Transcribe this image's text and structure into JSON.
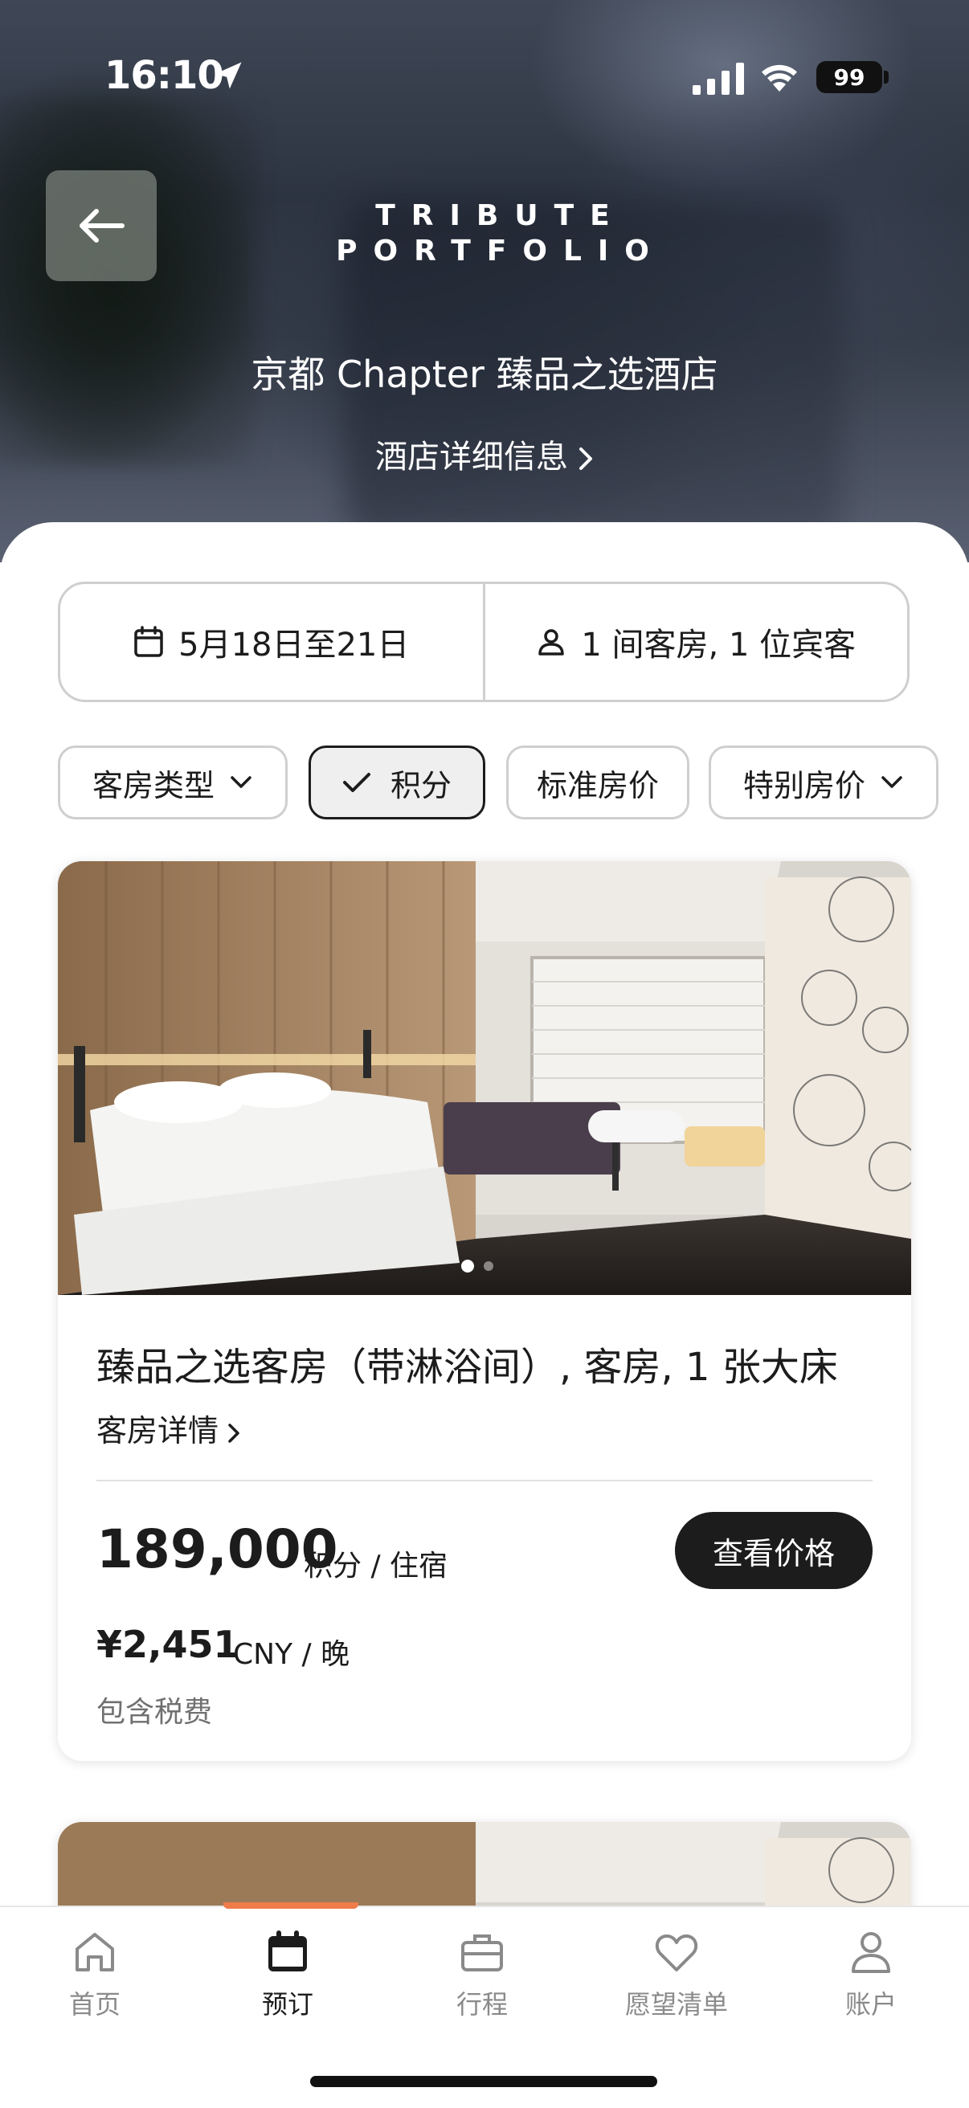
{
  "status_bar": {
    "time": "16:10",
    "battery": "99"
  },
  "hero": {
    "brand_line1": "TRIBUTE",
    "brand_line2": "PORTFOLIO",
    "hotel_name": "京都 Chapter 臻品之选酒店",
    "details_link": "酒店详细信息"
  },
  "search": {
    "dates": "5月18日至21日",
    "guests": "1 间客房, 1 位宾客"
  },
  "filters": [
    {
      "label": "客房类型",
      "has_dropdown": true,
      "selected": false
    },
    {
      "label": "积分",
      "has_check": true,
      "selected": true
    },
    {
      "label": "标准房价",
      "selected": false
    },
    {
      "label": "特别房价",
      "has_dropdown": true,
      "selected": false
    }
  ],
  "room_card": {
    "title": "臻品之选客房（带淋浴间）, 客房, 1 张大床",
    "details_link": "客房详情",
    "points": "189,000",
    "points_unit": "积分 / 住宿",
    "cash": "¥2,451",
    "cash_unit": "CNY / 晚",
    "tax_note": "包含税费",
    "cta": "查看价格",
    "carousel_total": 2,
    "carousel_active": 1
  },
  "tabbar": {
    "items": [
      {
        "label": "首页",
        "icon": "home-icon",
        "active": false
      },
      {
        "label": "预订",
        "icon": "calendar-icon",
        "active": true
      },
      {
        "label": "行程",
        "icon": "briefcase-icon",
        "active": false
      },
      {
        "label": "愿望清单",
        "icon": "heart-icon",
        "active": false
      },
      {
        "label": "账户",
        "icon": "person-icon",
        "active": false
      }
    ]
  },
  "colors": {
    "accent": "#f07c4a",
    "dark_button": "#1c1c1c",
    "border": "#cfcfcf"
  }
}
